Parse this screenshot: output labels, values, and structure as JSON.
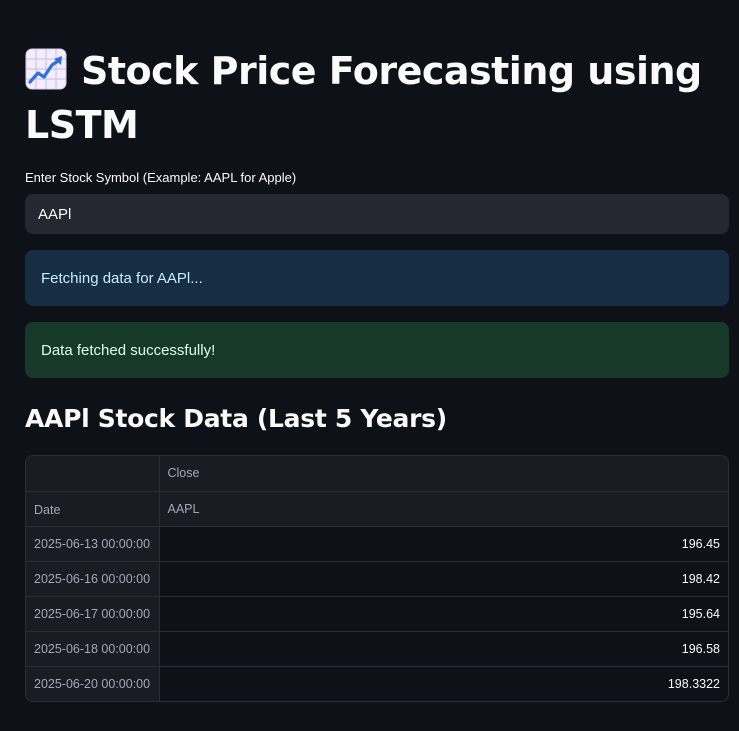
{
  "header": {
    "title": "Stock Price Forecasting using LSTM",
    "icon": "chart-increasing-icon"
  },
  "symbol_input": {
    "label": "Enter Stock Symbol (Example: AAPL for Apple)",
    "value": "AAPl"
  },
  "alerts": {
    "info": "Fetching data for AAPl...",
    "success": "Data fetched successfully!"
  },
  "section_title": "AAPl Stock Data (Last 5 Years)",
  "table": {
    "column_group": "Close",
    "column_ticker": "AAPL",
    "index_name": "Date",
    "rows": [
      {
        "date": "2025-06-13 00:00:00",
        "close": "196.45"
      },
      {
        "date": "2025-06-16 00:00:00",
        "close": "198.42"
      },
      {
        "date": "2025-06-17 00:00:00",
        "close": "195.64"
      },
      {
        "date": "2025-06-18 00:00:00",
        "close": "196.58"
      },
      {
        "date": "2025-06-20 00:00:00",
        "close": "198.3322"
      }
    ]
  },
  "colors": {
    "background": "#0e1117",
    "info_bg": "#172d43",
    "info_text": "#c7ebff",
    "success_bg": "#173928",
    "success_text": "#dffde9"
  }
}
